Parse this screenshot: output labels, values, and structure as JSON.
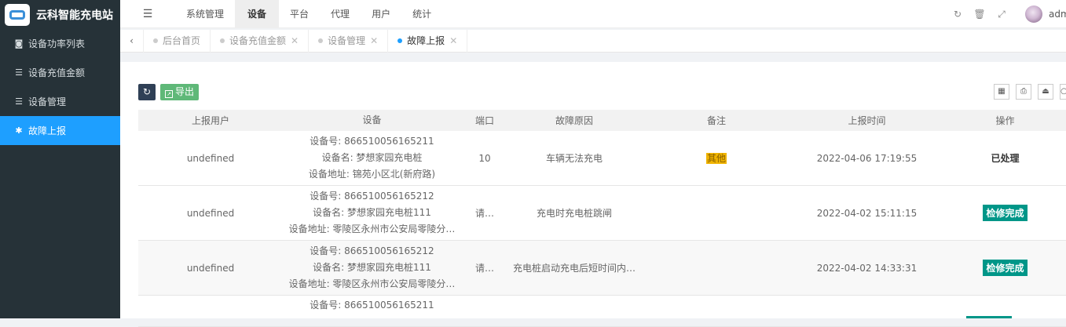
{
  "app": {
    "title": "云科智能充电站"
  },
  "sidebar": {
    "items": [
      {
        "label": "设备功率列表",
        "icon": "eye-icon"
      },
      {
        "label": "设备充值金额",
        "icon": "list-icon"
      },
      {
        "label": "设备管理",
        "icon": "list-icon"
      },
      {
        "label": "故障上报",
        "icon": "bug-icon"
      }
    ]
  },
  "topnav": {
    "items": [
      "系统管理",
      "设备",
      "平台",
      "代理",
      "用户",
      "统计"
    ],
    "active": "设备",
    "user": "admin"
  },
  "tabs": [
    {
      "label": "后台首页"
    },
    {
      "label": "设备充值金额"
    },
    {
      "label": "设备管理"
    },
    {
      "label": "故障上报"
    }
  ],
  "toolbar": {
    "export_label": "导出"
  },
  "table": {
    "headers": [
      "上报用户",
      "设备",
      "端口",
      "故障原因",
      "备注",
      "上报时间",
      "操作"
    ],
    "rows": [
      {
        "user": "undefined",
        "dev_no": "设备号: 866510056165211",
        "dev_name": "设备名: 梦想家园充电桩",
        "dev_addr": "设备地址: 锦苑小区北(新府路)",
        "port": "10",
        "reason": "车辆无法充电",
        "note": "其他",
        "time": "2022-04-06 17:19:55",
        "action": "已处理"
      },
      {
        "user": "undefined",
        "dev_no": "设备号: 866510056165212",
        "dev_name": "设备名: 梦想家园充电桩111",
        "dev_addr": "设备地址: 零陵区永州市公安局零陵分…",
        "port": "请…",
        "reason": "充电时充电桩跳闸",
        "note": "",
        "time": "2022-04-02 15:11:15",
        "action": "检修完成"
      },
      {
        "user": "undefined",
        "dev_no": "设备号: 866510056165212",
        "dev_name": "设备名: 梦想家园充电桩111",
        "dev_addr": "设备地址: 零陵区永州市公安局零陵分…",
        "port": "请…",
        "reason": "充电桩启动充电后短时间内…",
        "note": "",
        "time": "2022-04-02 14:33:31",
        "action": "检修完成"
      },
      {
        "user": "",
        "dev_no": "设备号: 866510056165211",
        "dev_name": "",
        "dev_addr": "",
        "port": "",
        "reason": "",
        "note": "",
        "time": "",
        "action": ""
      }
    ]
  }
}
